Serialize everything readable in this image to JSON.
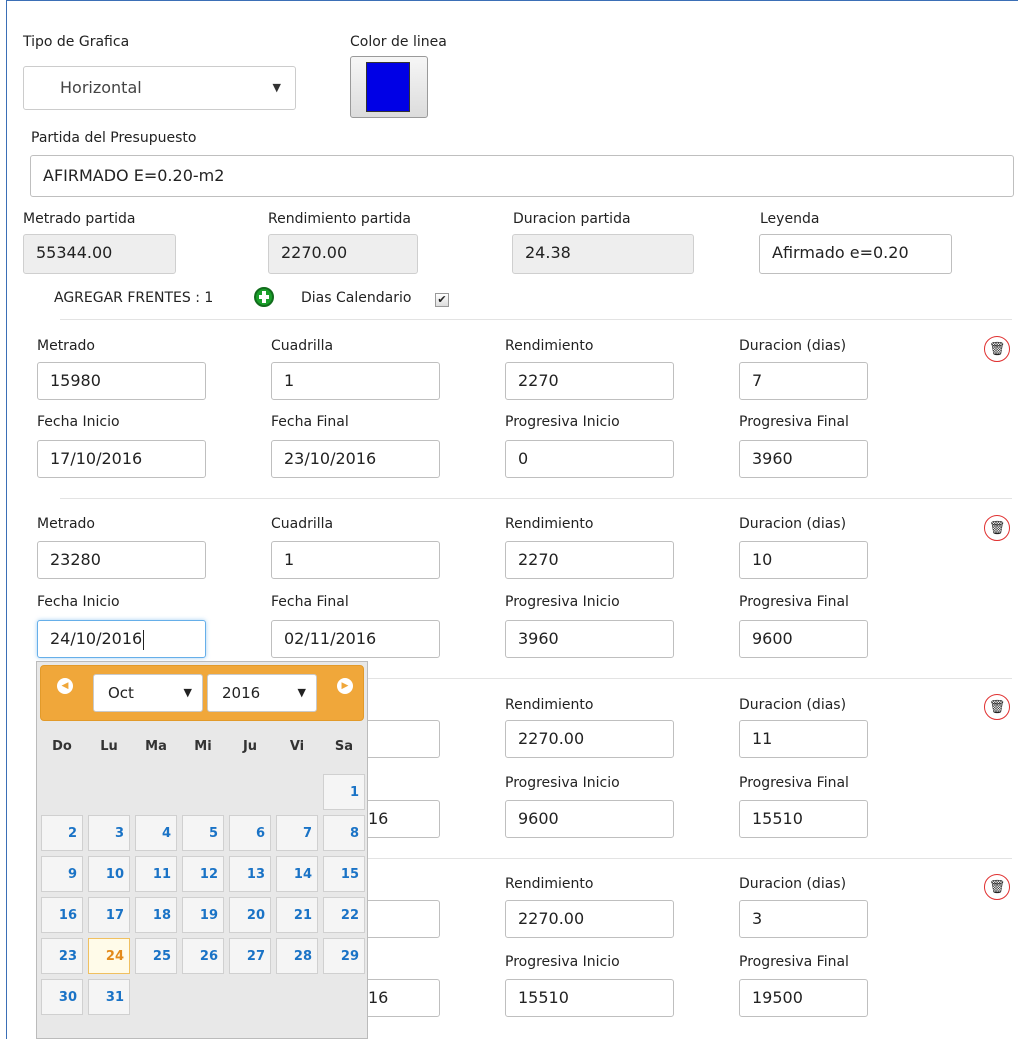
{
  "tipo_grafica": {
    "label": "Tipo de Grafica",
    "value": "Horizontal"
  },
  "color_linea": {
    "label": "Color de linea",
    "color": "#0000e6"
  },
  "partida": {
    "label": "Partida del Presupuesto",
    "value": "AFIRMADO E=0.20-m2"
  },
  "metrado_partida": {
    "label": "Metrado partida",
    "value": "55344.00"
  },
  "rendimiento_partida": {
    "label": "Rendimiento partida",
    "value": "2270.00"
  },
  "duracion_partida": {
    "label": "Duracion partida",
    "value": "24.38"
  },
  "leyenda": {
    "label": "Leyenda",
    "value": "Afirmado e=0.20"
  },
  "agregar_frentes": "AGREGAR FRENTES : 1",
  "dias_calendario": "Dias Calendario",
  "field_labels": {
    "metrado": "Metrado",
    "cuadrilla": "Cuadrilla",
    "rendimiento": "Rendimiento",
    "duracion": "Duracion (dias)",
    "fecha_inicio": "Fecha Inicio",
    "fecha_final": "Fecha Final",
    "prog_inicio": "Progresiva Inicio",
    "prog_final": "Progresiva Final"
  },
  "frentes": [
    {
      "metrado": "15980",
      "cuadrilla": "1",
      "rendimiento": "2270",
      "duracion": "7",
      "fecha_inicio": "17/10/2016",
      "fecha_final": "23/10/2016",
      "prog_inicio": "0",
      "prog_final": "3960"
    },
    {
      "metrado": "23280",
      "cuadrilla": "1",
      "rendimiento": "2270",
      "duracion": "10",
      "fecha_inicio": "24/10/2016",
      "fecha_final": "02/11/2016",
      "prog_inicio": "3960",
      "prog_final": "9600"
    },
    {
      "rendimiento": "2270.00",
      "duracion": "11",
      "fecha_final_tail": "16",
      "prog_inicio": "9600",
      "prog_final": "15510"
    },
    {
      "rendimiento": "2270.00",
      "duracion": "3",
      "fecha_final_tail": "16",
      "prog_inicio": "15510",
      "prog_final": "19500"
    }
  ],
  "datepicker": {
    "month": "Oct",
    "year": "2016",
    "weekdays": [
      "Do",
      "Lu",
      "Ma",
      "Mi",
      "Ju",
      "Vi",
      "Sa"
    ],
    "days": [
      "1",
      "2",
      "3",
      "4",
      "5",
      "6",
      "7",
      "8",
      "9",
      "10",
      "11",
      "12",
      "13",
      "14",
      "15",
      "16",
      "17",
      "18",
      "19",
      "20",
      "21",
      "22",
      "23",
      "24",
      "25",
      "26",
      "27",
      "28",
      "29",
      "30",
      "31"
    ],
    "selected": "24"
  }
}
